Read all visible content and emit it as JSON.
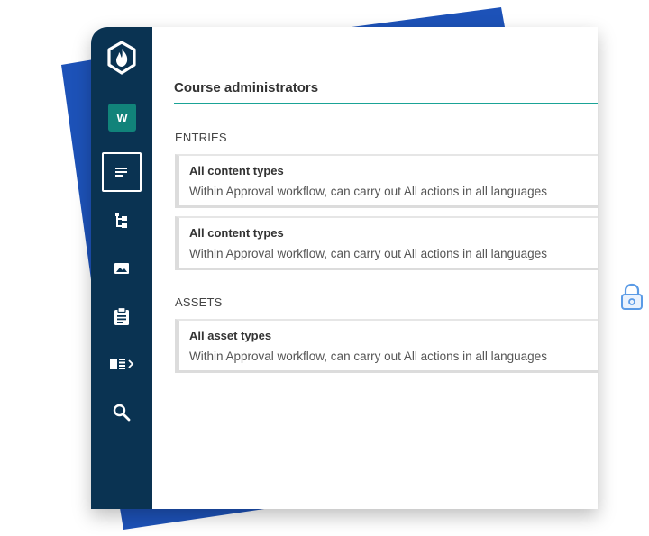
{
  "colors": {
    "sidebar": "#0a3352",
    "accent": "#1aa396",
    "workspace_badge": "#11837a",
    "backdrop_blue": "#1d52b8"
  },
  "sidebar": {
    "logo_icon": "flame-shield-logo-icon",
    "workspace_initial": "W",
    "items": [
      {
        "icon": "content-list-icon",
        "active": true
      },
      {
        "icon": "tree-structure-icon",
        "active": false
      },
      {
        "icon": "image-assets-icon",
        "active": false
      },
      {
        "icon": "clipboard-icon",
        "active": false
      },
      {
        "icon": "panel-expand-icon",
        "active": false
      },
      {
        "icon": "search-icon",
        "active": false
      }
    ]
  },
  "main": {
    "title": "Course administrators",
    "entries": {
      "label": "ENTRIES",
      "cards": [
        {
          "title": "All content types",
          "description": "Within Approval workflow, can carry out All actions in all languages"
        },
        {
          "title": "All content types",
          "description": "Within Approval workflow, can carry out All actions in all languages"
        }
      ]
    },
    "assets": {
      "label": "ASSETS",
      "cards": [
        {
          "title": "All asset types",
          "description": "Within Approval workflow, can carry out All actions in all languages"
        }
      ]
    }
  },
  "decor": {
    "lock_icon": "lock-icon"
  }
}
